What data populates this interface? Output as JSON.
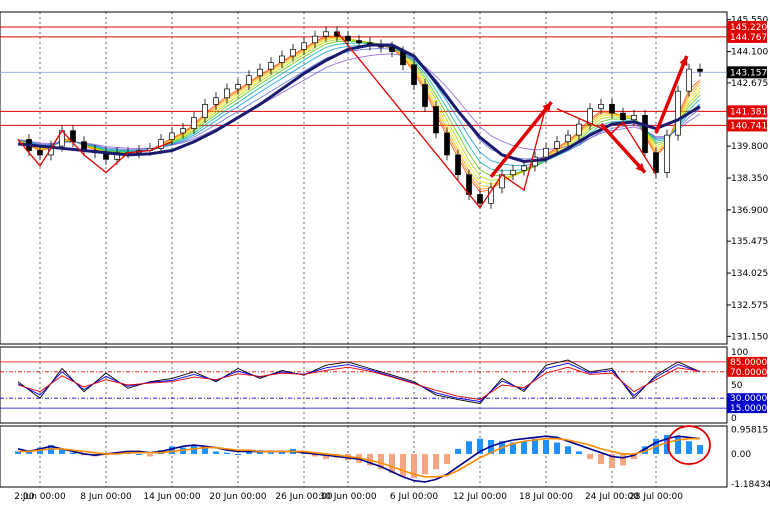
{
  "chart_data": [
    {
      "type": "candlestick",
      "title": "",
      "ylim": [
        130.8,
        145.9
      ],
      "y_ticks": [
        "145.550",
        "144.100",
        "142.675",
        "141.235",
        "139.800",
        "138.350",
        "136.900",
        "135.475",
        "134.025",
        "132.575",
        "131.150"
      ],
      "x_ticks": [
        "2 Jun 00:00",
        "8 Jun 00:00",
        "14 Jun 00:00",
        "20 Jun 00:00",
        "26 Jun 00:00",
        "30 Jun 00:00",
        "6 Jul 00:00",
        "12 Jul 00:00",
        "18 Jul 00:00",
        "24 Jul 00:00",
        "28 Jul 00:00"
      ],
      "first_x_label": ":00",
      "x_positions": [
        0,
        6,
        12,
        18,
        24,
        28,
        34,
        40,
        46,
        52,
        56
      ],
      "x_range": [
        -2,
        62
      ],
      "price_levels": [
        {
          "value": 145.22,
          "label": "145.220",
          "color": "#e00000"
        },
        {
          "value": 144.767,
          "label": "144.767",
          "color": "#e00000"
        },
        {
          "value": 141.381,
          "label": "141.381",
          "color": "#e00000"
        },
        {
          "value": 140.741,
          "label": "140.741",
          "color": "#e00000"
        }
      ],
      "current_price": {
        "value": 143.157,
        "label": "143.157"
      },
      "close_path": {
        "x": [
          -2,
          -1,
          0,
          1,
          2,
          3,
          4,
          5,
          6,
          7,
          8,
          9,
          10,
          11,
          12,
          13,
          14,
          15,
          16,
          17,
          18,
          19,
          20,
          21,
          22,
          23,
          24,
          25,
          26,
          27,
          28,
          29,
          30,
          31,
          32,
          33,
          34,
          35,
          36,
          37,
          38,
          39,
          40,
          41,
          42,
          43,
          44,
          45,
          46,
          47,
          48,
          49,
          50,
          51,
          52,
          53,
          54,
          55,
          56,
          57,
          58,
          59,
          60
        ],
        "y": [
          140.1,
          139.6,
          139.4,
          139.8,
          140.5,
          140.0,
          139.6,
          139.5,
          139.2,
          139.5,
          139.5,
          139.6,
          139.7,
          140.1,
          140.4,
          140.6,
          141.1,
          141.7,
          142.0,
          142.4,
          142.6,
          143.0,
          143.3,
          143.6,
          143.9,
          144.2,
          144.5,
          144.8,
          145.0,
          144.8,
          144.6,
          144.5,
          144.4,
          144.3,
          144.1,
          143.5,
          142.6,
          141.6,
          140.4,
          139.4,
          138.5,
          137.6,
          137.2,
          137.9,
          138.5,
          138.7,
          138.9,
          139.3,
          139.7,
          140.0,
          140.3,
          140.8,
          141.5,
          141.7,
          141.3,
          141.0,
          141.2,
          139.5,
          138.6,
          140.3,
          142.3,
          143.3,
          143.2
        ]
      },
      "ma_slow": {
        "x": [
          -2,
          0,
          2,
          4,
          6,
          8,
          10,
          12,
          14,
          16,
          18,
          20,
          22,
          24,
          26,
          28,
          30,
          32,
          34,
          36,
          38,
          40,
          42,
          44,
          46,
          48,
          50,
          52,
          54,
          56,
          58,
          60
        ],
        "y": [
          139.9,
          139.8,
          139.7,
          139.6,
          139.5,
          139.4,
          139.45,
          139.6,
          140.0,
          140.5,
          141.1,
          141.7,
          142.4,
          143.1,
          143.7,
          144.2,
          144.4,
          144.4,
          143.9,
          142.7,
          141.4,
          140.2,
          139.4,
          139.1,
          139.2,
          139.7,
          140.3,
          140.8,
          140.9,
          140.6,
          141.0,
          141.6
        ]
      },
      "zigzag_lines": [
        {
          "x": [
            -2,
            0,
            2,
            4,
            6,
            8,
            10,
            12
          ],
          "y": [
            140.1,
            138.9,
            140.5,
            139.4,
            138.6,
            139.5,
            139.6,
            140.0
          ]
        },
        {
          "x": [
            27,
            40
          ],
          "y": [
            145.0,
            137.0
          ]
        },
        {
          "x": [
            40,
            42,
            44,
            46
          ],
          "y": [
            137.0,
            138.5,
            137.8,
            141.6
          ]
        },
        {
          "x": [
            47,
            52,
            53,
            56
          ],
          "y": [
            141.5,
            140.4,
            140.9,
            138.5
          ]
        }
      ],
      "arrows": [
        {
          "x": [
            41,
            46.5
          ],
          "y": [
            138.4,
            141.8
          ]
        },
        {
          "x": [
            51,
            55
          ],
          "y": [
            140.8,
            138.6
          ]
        },
        {
          "x": [
            56,
            58.8
          ],
          "y": [
            140.4,
            143.9
          ]
        }
      ]
    },
    {
      "type": "line",
      "title": "",
      "ylim": [
        0,
        100
      ],
      "y_ticks": [
        "100",
        "50",
        "0"
      ],
      "levels": [
        {
          "value": 85,
          "label": "85.0000",
          "color": "#e00000"
        },
        {
          "value": 70,
          "label": "70.0000",
          "color": "#e00000"
        },
        {
          "value": 30,
          "label": "30.0000",
          "color": "#0000c8"
        },
        {
          "value": 15,
          "label": "15.0000",
          "color": "#0000c8"
        }
      ],
      "x": [
        -2,
        0,
        2,
        4,
        6,
        8,
        10,
        12,
        14,
        16,
        18,
        20,
        22,
        24,
        26,
        28,
        30,
        32,
        34,
        36,
        38,
        40,
        42,
        44,
        46,
        48,
        50,
        52,
        54,
        56,
        58,
        60
      ],
      "series": [
        {
          "color": "#000000",
          "values": [
            55,
            30,
            75,
            40,
            68,
            45,
            55,
            60,
            70,
            55,
            75,
            60,
            72,
            65,
            80,
            85,
            75,
            65,
            55,
            35,
            28,
            22,
            60,
            40,
            80,
            88,
            70,
            75,
            30,
            65,
            85,
            70
          ]
        },
        {
          "color": "#0000ff",
          "values": [
            52,
            35,
            70,
            43,
            63,
            48,
            54,
            57,
            66,
            57,
            71,
            62,
            70,
            66,
            76,
            81,
            73,
            63,
            53,
            38,
            30,
            25,
            56,
            43,
            75,
            83,
            68,
            72,
            34,
            62,
            81,
            70
          ]
        },
        {
          "color": "#e00000",
          "values": [
            50,
            40,
            64,
            47,
            58,
            50,
            53,
            55,
            62,
            58,
            67,
            63,
            68,
            66,
            72,
            77,
            71,
            62,
            52,
            42,
            33,
            28,
            50,
            46,
            68,
            77,
            66,
            68,
            40,
            58,
            76,
            71
          ]
        }
      ]
    },
    {
      "type": "bar",
      "title": "",
      "ylim": [
        -1.3,
        1.1
      ],
      "y_ticks": [
        "0.95815",
        "0.00",
        "-1.18434"
      ],
      "x": [
        -2,
        -1,
        0,
        1,
        2,
        3,
        4,
        5,
        6,
        7,
        8,
        9,
        10,
        11,
        12,
        13,
        14,
        15,
        16,
        17,
        18,
        19,
        20,
        21,
        22,
        23,
        24,
        25,
        26,
        27,
        28,
        29,
        30,
        31,
        32,
        33,
        34,
        35,
        36,
        37,
        38,
        39,
        40,
        41,
        42,
        43,
        44,
        45,
        46,
        47,
        48,
        49,
        50,
        51,
        52,
        53,
        54,
        55,
        56,
        57,
        58,
        59,
        60
      ],
      "values": [
        0.1,
        0.15,
        0.25,
        0.35,
        0.2,
        0.05,
        -0.05,
        -0.1,
        -0.05,
        0.05,
        0.1,
        0.0,
        -0.1,
        0.15,
        0.3,
        0.25,
        0.35,
        0.3,
        0.1,
        0.05,
        0.0,
        0.1,
        0.15,
        0.05,
        0.1,
        0.2,
        0.05,
        -0.1,
        -0.2,
        -0.15,
        -0.25,
        -0.35,
        -0.45,
        -0.6,
        -0.75,
        -0.9,
        -0.95,
        -0.8,
        -0.6,
        -0.4,
        0.2,
        0.5,
        0.6,
        0.55,
        0.5,
        0.45,
        0.5,
        0.6,
        0.55,
        0.45,
        0.3,
        0.1,
        -0.2,
        -0.4,
        -0.55,
        -0.45,
        -0.2,
        0.3,
        0.6,
        0.75,
        0.7,
        0.5,
        0.35
      ],
      "positive_color": "#1e90ff",
      "negative_color": "#f4a582",
      "series": [
        {
          "color": "#00008b",
          "values": [
            0.2,
            0.1,
            0.2,
            0.3,
            0.2,
            0.1,
            0.0,
            -0.05,
            0.0,
            0.05,
            0.1,
            0.1,
            0.05,
            0.1,
            0.2,
            0.3,
            0.35,
            0.3,
            0.25,
            0.15,
            0.1,
            0.1,
            0.1,
            0.1,
            0.1,
            0.1,
            0.05,
            0.0,
            -0.05,
            -0.1,
            -0.15,
            -0.2,
            -0.35,
            -0.5,
            -0.7,
            -0.9,
            -1.05,
            -1.1,
            -1.0,
            -0.8,
            -0.5,
            -0.2,
            0.1,
            0.3,
            0.45,
            0.55,
            0.6,
            0.65,
            0.7,
            0.65,
            0.5,
            0.35,
            0.2,
            0.05,
            -0.1,
            -0.15,
            -0.05,
            0.2,
            0.45,
            0.6,
            0.7,
            0.65,
            0.6
          ]
        },
        {
          "color": "#ff8c00",
          "values": [
            0.1,
            0.1,
            0.15,
            0.2,
            0.2,
            0.15,
            0.1,
            0.05,
            0.0,
            0.0,
            0.05,
            0.05,
            0.05,
            0.05,
            0.1,
            0.15,
            0.2,
            0.25,
            0.25,
            0.2,
            0.15,
            0.15,
            0.1,
            0.1,
            0.1,
            0.1,
            0.1,
            0.05,
            0.0,
            -0.05,
            -0.1,
            -0.15,
            -0.25,
            -0.35,
            -0.5,
            -0.65,
            -0.8,
            -0.9,
            -0.9,
            -0.85,
            -0.65,
            -0.4,
            -0.15,
            0.05,
            0.25,
            0.4,
            0.5,
            0.55,
            0.6,
            0.6,
            0.55,
            0.45,
            0.35,
            0.2,
            0.1,
            0.0,
            0.0,
            0.1,
            0.3,
            0.45,
            0.55,
            0.6,
            0.6
          ]
        }
      ]
    }
  ]
}
